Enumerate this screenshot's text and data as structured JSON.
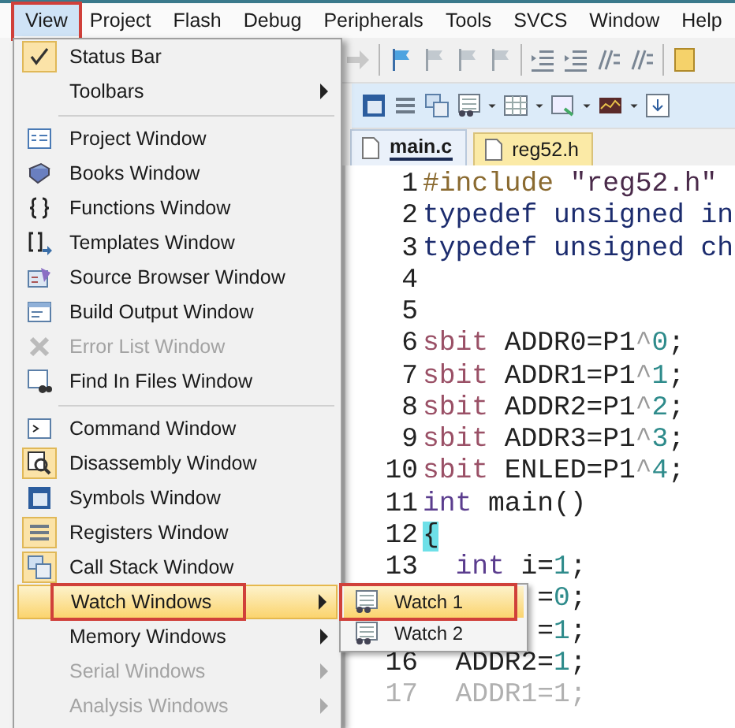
{
  "menubar": [
    {
      "label": "View",
      "selected": true,
      "marked": true
    },
    {
      "label": "Project",
      "selected": false,
      "marked": false
    },
    {
      "label": "Flash",
      "selected": false,
      "marked": false
    },
    {
      "label": "Debug",
      "selected": false,
      "marked": false
    },
    {
      "label": "Peripherals",
      "selected": false,
      "marked": false
    },
    {
      "label": "Tools",
      "selected": false,
      "marked": false
    },
    {
      "label": "SVCS",
      "selected": false,
      "marked": false
    },
    {
      "label": "Window",
      "selected": false,
      "marked": false
    },
    {
      "label": "Help",
      "selected": false,
      "marked": false
    }
  ],
  "view_menu": {
    "items": [
      {
        "kind": "item",
        "label": "Status Bar",
        "checked": true,
        "disabled": false,
        "submenu": false,
        "selected": false,
        "marked": false
      },
      {
        "kind": "item",
        "label": "Toolbars",
        "checked": false,
        "disabled": false,
        "submenu": true,
        "selected": false,
        "marked": false
      },
      {
        "kind": "separator"
      },
      {
        "kind": "item",
        "label": "Project Window",
        "checked": false,
        "disabled": false,
        "submenu": false,
        "selected": false,
        "marked": false
      },
      {
        "kind": "item",
        "label": "Books Window",
        "checked": false,
        "disabled": false,
        "submenu": false,
        "selected": false,
        "marked": false
      },
      {
        "kind": "item",
        "label": "Functions Window",
        "checked": false,
        "disabled": false,
        "submenu": false,
        "selected": false,
        "marked": false
      },
      {
        "kind": "item",
        "label": "Templates Window",
        "checked": false,
        "disabled": false,
        "submenu": false,
        "selected": false,
        "marked": false
      },
      {
        "kind": "item",
        "label": "Source Browser Window",
        "checked": false,
        "disabled": false,
        "submenu": false,
        "selected": false,
        "marked": false
      },
      {
        "kind": "item",
        "label": "Build Output Window",
        "checked": false,
        "disabled": false,
        "submenu": false,
        "selected": false,
        "marked": false
      },
      {
        "kind": "item",
        "label": "Error List Window",
        "checked": false,
        "disabled": true,
        "submenu": false,
        "selected": false,
        "marked": false
      },
      {
        "kind": "item",
        "label": "Find In Files Window",
        "checked": false,
        "disabled": false,
        "submenu": false,
        "selected": false,
        "marked": false
      },
      {
        "kind": "separator"
      },
      {
        "kind": "item",
        "label": "Command Window",
        "checked": false,
        "disabled": false,
        "submenu": false,
        "selected": false,
        "marked": false
      },
      {
        "kind": "item",
        "label": "Disassembly Window",
        "checked": true,
        "disabled": false,
        "submenu": false,
        "selected": false,
        "marked": false
      },
      {
        "kind": "item",
        "label": "Symbols Window",
        "checked": false,
        "disabled": false,
        "submenu": false,
        "selected": false,
        "marked": false
      },
      {
        "kind": "item",
        "label": "Registers Window",
        "checked": true,
        "disabled": false,
        "submenu": false,
        "selected": false,
        "marked": false
      },
      {
        "kind": "item",
        "label": "Call Stack Window",
        "checked": true,
        "disabled": false,
        "submenu": false,
        "selected": false,
        "marked": false
      },
      {
        "kind": "item",
        "label": "Watch Windows",
        "checked": false,
        "disabled": false,
        "submenu": true,
        "selected": true,
        "marked": true
      },
      {
        "kind": "item",
        "label": "Memory Windows",
        "checked": false,
        "disabled": false,
        "submenu": true,
        "selected": false,
        "marked": false
      },
      {
        "kind": "item",
        "label": "Serial Windows",
        "checked": false,
        "disabled": true,
        "submenu": true,
        "selected": false,
        "marked": false
      },
      {
        "kind": "item",
        "label": "Analysis Windows",
        "checked": false,
        "disabled": true,
        "submenu": true,
        "selected": false,
        "marked": false
      }
    ]
  },
  "watch_submenu": {
    "items": [
      {
        "label": "Watch 1",
        "selected": true,
        "marked": true
      },
      {
        "label": "Watch 2",
        "selected": false,
        "marked": false
      }
    ]
  },
  "tabs": [
    {
      "label": "main.c",
      "selected": true
    },
    {
      "label": "reg52.h",
      "selected": false
    }
  ],
  "editor": {
    "lines": [
      {
        "number": "1",
        "kind": "full",
        "tokens": [
          {
            "kind": "pre",
            "text": "#include"
          },
          {
            "kind": "str",
            "text": " \"reg52.h\""
          }
        ]
      },
      {
        "number": "2",
        "kind": "full",
        "tokens": [
          {
            "kind": "type",
            "text": "typedef unsigned in"
          }
        ]
      },
      {
        "number": "3",
        "kind": "full",
        "tokens": [
          {
            "kind": "type",
            "text": "typedef unsigned ch"
          }
        ]
      },
      {
        "number": "4",
        "kind": "full"
      },
      {
        "number": "5",
        "kind": "full"
      },
      {
        "number": "6",
        "kind": "full",
        "tokens": [
          {
            "kind": "kw",
            "text": "sbit"
          },
          {
            "kind": "plain",
            "text": " ADDR0=P1"
          },
          {
            "kind": "op",
            "text": "^"
          },
          {
            "kind": "num",
            "text": "0"
          },
          {
            "kind": "plain",
            "text": ";"
          }
        ]
      },
      {
        "number": "7",
        "kind": "full",
        "tokens": [
          {
            "kind": "kw",
            "text": "sbit"
          },
          {
            "kind": "plain",
            "text": " ADDR1=P1"
          },
          {
            "kind": "op",
            "text": "^"
          },
          {
            "kind": "num",
            "text": "1"
          },
          {
            "kind": "plain",
            "text": ";"
          }
        ]
      },
      {
        "number": "8",
        "kind": "full",
        "tokens": [
          {
            "kind": "kw",
            "text": "sbit"
          },
          {
            "kind": "plain",
            "text": " ADDR2=P1"
          },
          {
            "kind": "op",
            "text": "^"
          },
          {
            "kind": "num",
            "text": "2"
          },
          {
            "kind": "plain",
            "text": ";"
          }
        ]
      },
      {
        "number": "9",
        "kind": "full",
        "tokens": [
          {
            "kind": "kw",
            "text": "sbit"
          },
          {
            "kind": "plain",
            "text": " ADDR3=P1"
          },
          {
            "kind": "op",
            "text": "^"
          },
          {
            "kind": "num",
            "text": "3"
          },
          {
            "kind": "plain",
            "text": ";"
          }
        ]
      },
      {
        "number": "10",
        "kind": "full",
        "tokens": [
          {
            "kind": "kw",
            "text": "sbit"
          },
          {
            "kind": "plain",
            "text": " ENLED=P1"
          },
          {
            "kind": "op",
            "text": "^"
          },
          {
            "kind": "num",
            "text": "4"
          },
          {
            "kind": "plain",
            "text": ";"
          }
        ]
      },
      {
        "number": "11",
        "kind": "full",
        "tokens": [
          {
            "kind": "kw2",
            "text": "int"
          },
          {
            "kind": "plain",
            "text": " main()"
          }
        ]
      },
      {
        "number": "12",
        "kind": "full",
        "tokens": [
          {
            "kind": "match",
            "text": "{"
          }
        ]
      },
      {
        "number": "13",
        "kind": "full",
        "tokens": [
          {
            "kind": "kw2",
            "text": "  int"
          },
          {
            "kind": "plain",
            "text": " i="
          },
          {
            "kind": "num",
            "text": "1"
          },
          {
            "kind": "plain",
            "text": ";"
          }
        ]
      },
      {
        "kind": "partial",
        "tokens": [
          {
            "kind": "plain",
            "text": "="
          },
          {
            "kind": "num",
            "text": "0"
          },
          {
            "kind": "plain",
            "text": ";"
          }
        ]
      },
      {
        "kind": "partial",
        "tokens": [
          {
            "kind": "plain",
            "text": "="
          },
          {
            "kind": "num",
            "text": "1"
          },
          {
            "kind": "plain",
            "text": ";"
          }
        ]
      },
      {
        "number": "16",
        "kind": "full",
        "tokens": [
          {
            "kind": "plain",
            "text": "  ADDR2="
          },
          {
            "kind": "num",
            "text": "1"
          },
          {
            "kind": "plain",
            "text": ";"
          }
        ]
      },
      {
        "number": "17",
        "kind": "dim",
        "tokens": [
          {
            "kind": "plain",
            "text": "  ADDR1=1;"
          }
        ]
      }
    ]
  }
}
